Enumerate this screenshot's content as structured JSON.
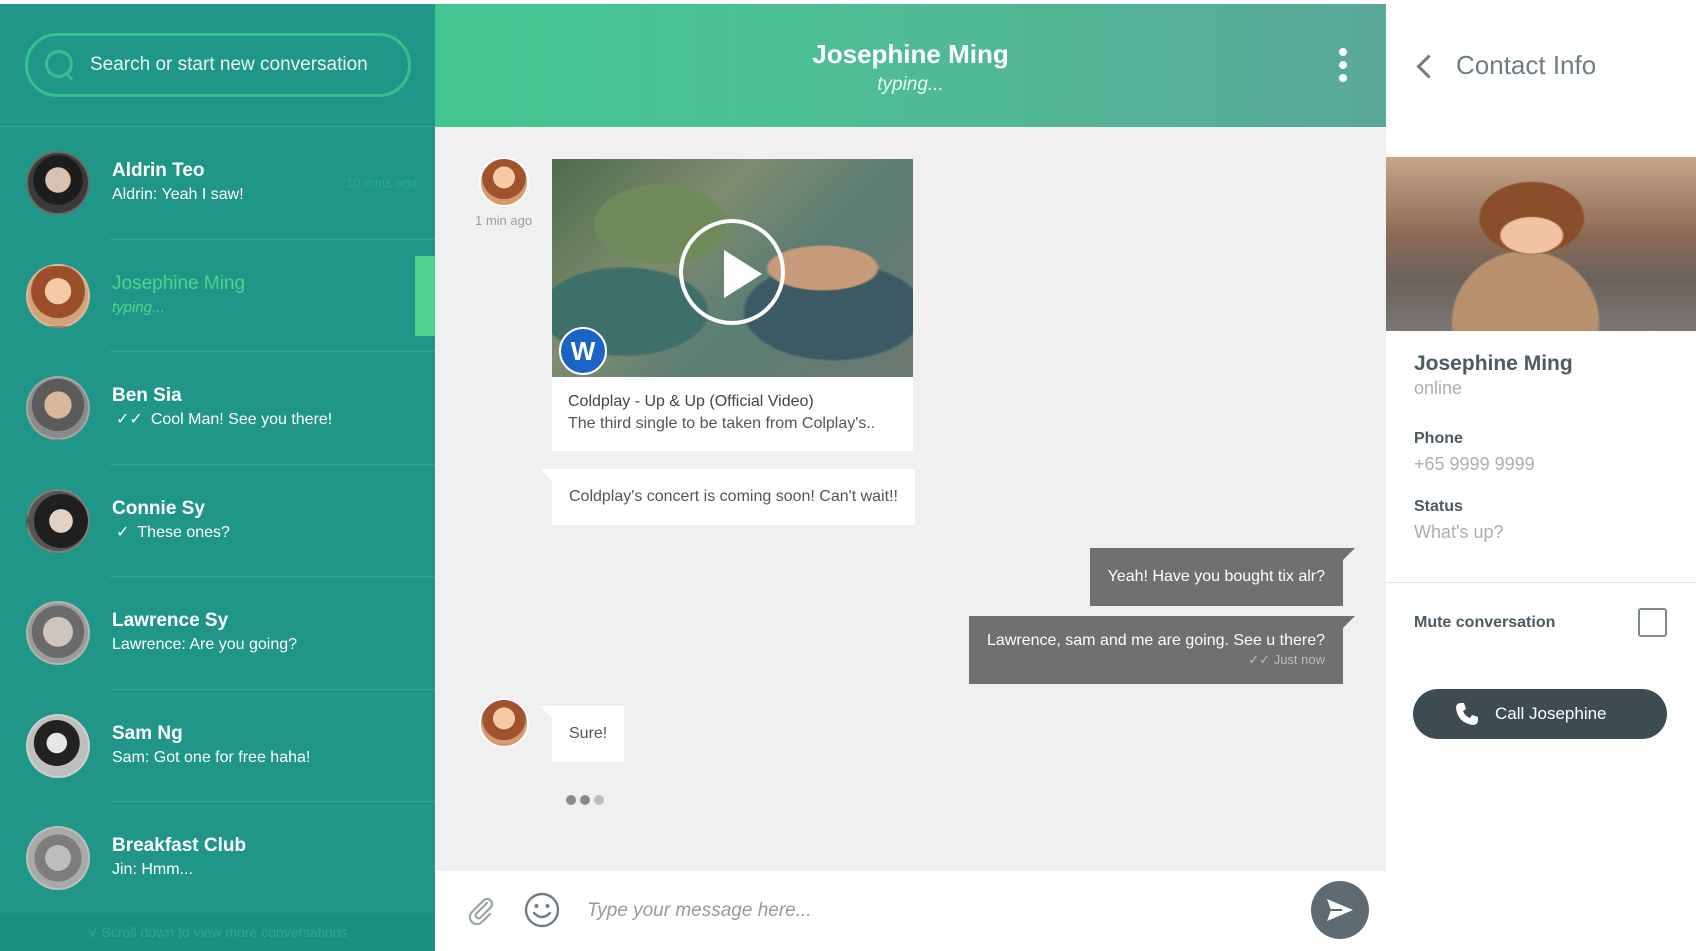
{
  "sidebar": {
    "search_placeholder": "Search or start new conversation",
    "conversations": [
      {
        "name": "Aldrin Teo",
        "preview": "Aldrin: Yeah I saw!",
        "time": "10 mins ago",
        "tick": ""
      },
      {
        "name": "Josephine Ming",
        "preview": "typing...",
        "time": "",
        "tick": ""
      },
      {
        "name": "Ben Sia",
        "preview": "Cool Man! See you there!",
        "time": "",
        "tick": "✓✓"
      },
      {
        "name": "Connie Sy",
        "preview": "These ones?",
        "time": "",
        "tick": "✓"
      },
      {
        "name": "Lawrence Sy",
        "preview": "Lawrence: Are you going?",
        "time": "",
        "tick": ""
      },
      {
        "name": "Sam Ng",
        "preview": "Sam: Got one for free haha!",
        "time": "",
        "tick": ""
      },
      {
        "name": "Breakfast Club",
        "preview": "Jin: Hmm...",
        "time": "",
        "tick": ""
      }
    ],
    "footer": "∨ Scroll down to view more conversations"
  },
  "chat": {
    "title": "Josephine Ming",
    "status": "typing...",
    "first_message_time": "1 min ago",
    "video": {
      "title": "Coldplay - Up & Up (Official Video)",
      "description": "The third single to be taken from Colplay's..",
      "logo": "W"
    },
    "messages": {
      "incoming_1": "Coldplay's concert is coming soon! Can't wait!!",
      "outgoing_1": "Yeah! Have you bought tix alr?",
      "outgoing_2": "Lawrence, sam and me are going. See u there?",
      "outgoing_2_time": "✓✓ Just now",
      "incoming_2": "Sure!"
    },
    "composer_placeholder": "Type your message here..."
  },
  "contact": {
    "header": "Contact Info",
    "name": "Josephine Ming",
    "status": "online",
    "phone_label": "Phone",
    "phone": "+65 9999 9999",
    "status_label": "Status",
    "status_text": "What's up?",
    "mute_label": "Mute conversation",
    "mute_checked": false,
    "call_label": "Call Josephine"
  },
  "colors": {
    "sidebar_bg": "#1f9688",
    "accent_green": "#4ed38f",
    "header_gradient_start": "#43c792",
    "outgoing_bubble": "#707070",
    "call_button": "#3d4b52"
  },
  "icons": [
    "search-icon",
    "kebab-menu-icon",
    "play-icon",
    "paperclip-icon",
    "emoji-icon",
    "send-icon",
    "back-chevron-icon",
    "phone-icon",
    "double-check-icon",
    "check-icon"
  ]
}
